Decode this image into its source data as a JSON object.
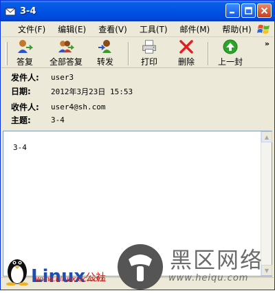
{
  "window": {
    "title": "3-4"
  },
  "menu": [
    {
      "label": "文件(F)"
    },
    {
      "label": "编辑(E)"
    },
    {
      "label": "查看(V)"
    },
    {
      "label": "工具(T)"
    },
    {
      "label": "邮件(M)"
    },
    {
      "label": "帮助(H)"
    }
  ],
  "toolbar": {
    "reply": "答复",
    "reply_all": "全部答复",
    "forward": "转发",
    "print": "打印",
    "delete": "删除",
    "previous": "上一封",
    "more": "»"
  },
  "headers": {
    "from_label": "发件人:",
    "from_value": "user3",
    "date_label": "日期:",
    "date_value": "2012年3月23日 15:53",
    "to_label": "收件人:",
    "to_value": "user4@sh.com",
    "subject_label": "主题:",
    "subject_value": "3-4"
  },
  "body": {
    "text": "3-4"
  },
  "watermarks": {
    "left_brand": "Linux",
    "left_brand_suffix": "公社",
    "left_url": "www.Linuxidc.com",
    "right_brand": "黑区网络",
    "right_url": "www.heiqu.com"
  },
  "colors": {
    "titlebar": "#0054e3",
    "window_bg": "#ece9d8",
    "close_button": "#c6401c",
    "delete_icon": "#e02020",
    "previous_icon": "#2aa52a"
  },
  "icons": {
    "title": "email-envelope-icon",
    "reply": "reply-person-icon",
    "reply_all": "reply-all-people-icon",
    "forward": "forward-person-icon",
    "print": "printer-icon",
    "delete": "red-x-icon",
    "previous": "green-up-arrow-icon"
  }
}
